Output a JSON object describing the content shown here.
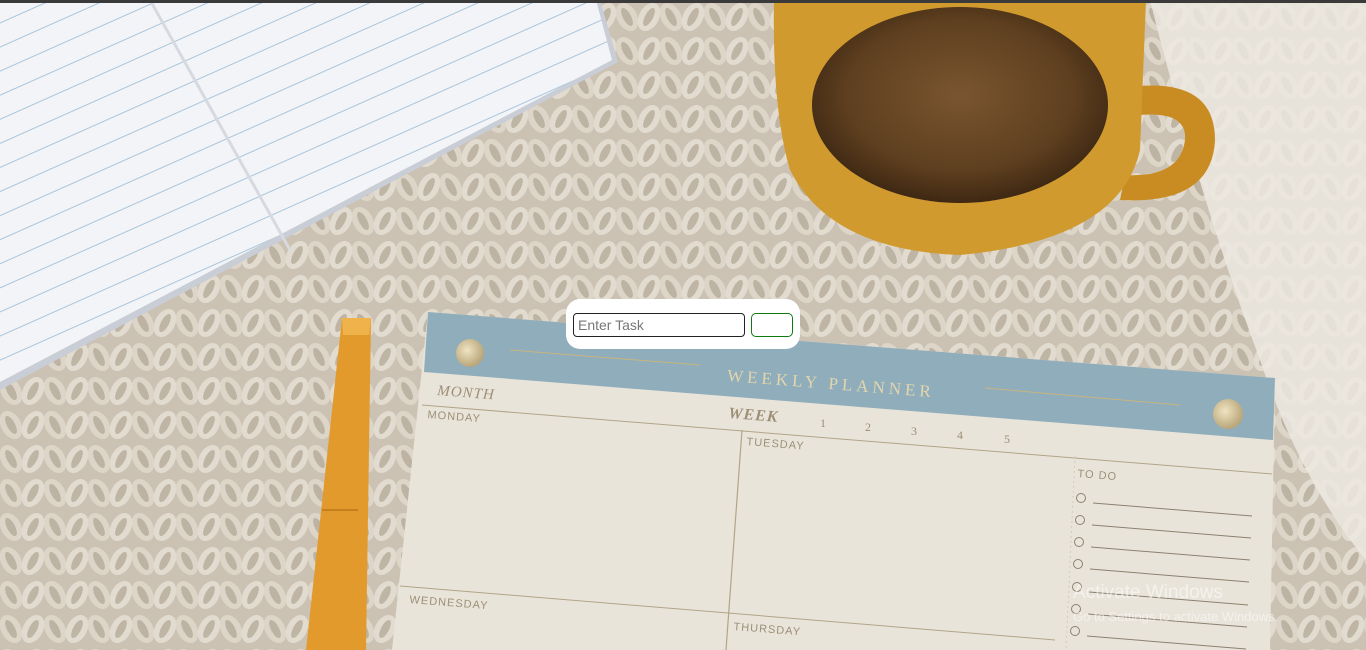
{
  "task_form": {
    "input_placeholder": "Enter Task",
    "input_value": "",
    "add_label": ""
  },
  "planner": {
    "title": "WEEKLY PLANNER",
    "month_label": "MONTH",
    "week_label": "WEEK",
    "week_numbers": [
      "1",
      "2",
      "3",
      "4",
      "5"
    ],
    "days": [
      "MONDAY",
      "TUESDAY",
      "WEDNESDAY",
      "THURSDAY"
    ],
    "todo_label": "TO DO"
  },
  "watermark": {
    "title": "Activate Windows",
    "subtitle": "Go to Settings to activate Windows."
  },
  "colors": {
    "planner_header": "#8fadbb",
    "planner_paper": "#ebe6dc",
    "mug": "#d19a2e",
    "pen": "#e39a2d",
    "blanket": "#cfc6b8",
    "add_button_border": "#0f7a0f"
  }
}
